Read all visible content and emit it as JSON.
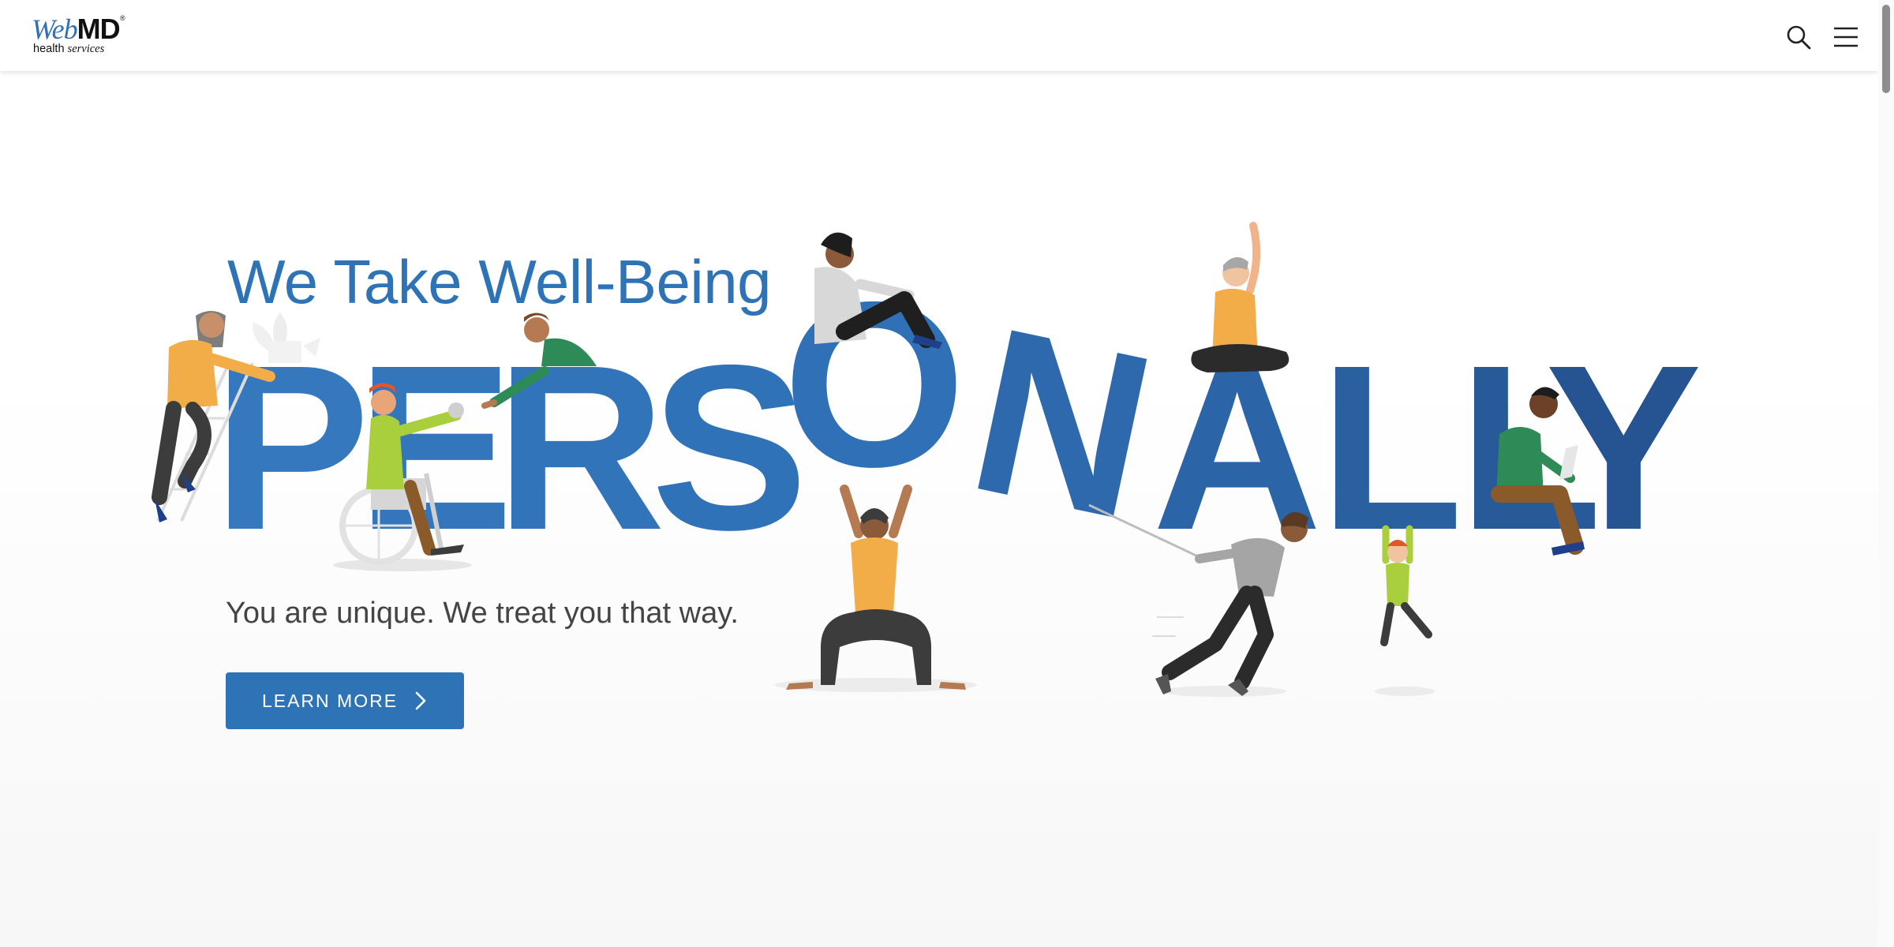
{
  "header": {
    "logo": {
      "web": "Web",
      "md": "MD",
      "tm": "®",
      "sub_health": "health",
      "sub_services": "services"
    },
    "search_icon": "search-icon",
    "menu_icon": "hamburger-menu-icon"
  },
  "hero": {
    "headline": "We Take Well-Being",
    "big_word": "PERSONALLY",
    "tagline": "You are unique. We treat you that way.",
    "cta_label": "LEARN MORE",
    "cta_icon": "chevron-right-icon"
  },
  "colors": {
    "brand_blue": "#2f73b7",
    "letter_blue": "#2d66ab",
    "orange": "#f2ad48",
    "green": "#2e8b57",
    "lime": "#a9cf3c"
  }
}
